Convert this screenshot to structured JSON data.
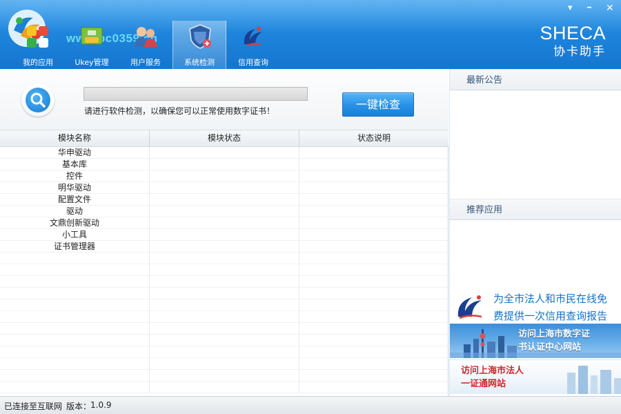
{
  "window": {
    "brand": "SHECA",
    "brand_sub": "协卡助手",
    "watermark": "www.pc0359.cn",
    "menu_glyph": "▾",
    "minimize_glyph": "━",
    "close_glyph": "✕"
  },
  "nav": [
    {
      "label": "我的应用",
      "icon": "apps-icon"
    },
    {
      "label": "Ukey管理",
      "icon": "ukey-icon"
    },
    {
      "label": "用户服务",
      "icon": "users-icon"
    },
    {
      "label": "系统检测",
      "icon": "shield-check-icon",
      "active": true
    },
    {
      "label": "信用查询",
      "icon": "credit-query-icon"
    }
  ],
  "check": {
    "progress": 0,
    "hint": "请进行软件检测，以确保您可以正常使用数字证书！",
    "button": "一键检查"
  },
  "table": {
    "columns": [
      "模块名称",
      "模块状态",
      "状态说明"
    ],
    "rows": [
      [
        "华申驱动",
        "",
        ""
      ],
      [
        "基本库",
        "",
        ""
      ],
      [
        "控件",
        "",
        ""
      ],
      [
        "明华驱动",
        "",
        ""
      ],
      [
        "配置文件",
        "",
        ""
      ],
      [
        "驱动",
        "",
        ""
      ],
      [
        "文鼎创新驱动",
        "",
        ""
      ],
      [
        "小工具",
        "",
        ""
      ],
      [
        "证书管理器",
        "",
        ""
      ]
    ]
  },
  "side": {
    "notice_title": "最新公告",
    "recommend_title": "推荐应用",
    "promo_line1": "为全市法人和市民在线免",
    "promo_line2": "费提供一次信用查询报告",
    "banner1_line1": "访问上海市数字证",
    "banner1_line2": "书认证中心网站",
    "banner2_line1": "访问上海市法人",
    "banner2_line2": "一证通网站"
  },
  "status": {
    "connection": "已连接至互联网",
    "version_label": "版本：",
    "version": "1.0.9"
  },
  "colors": {
    "header_blue": "#1f86dd",
    "button_blue": "#2a93e6",
    "banner_red": "#d0262d"
  }
}
